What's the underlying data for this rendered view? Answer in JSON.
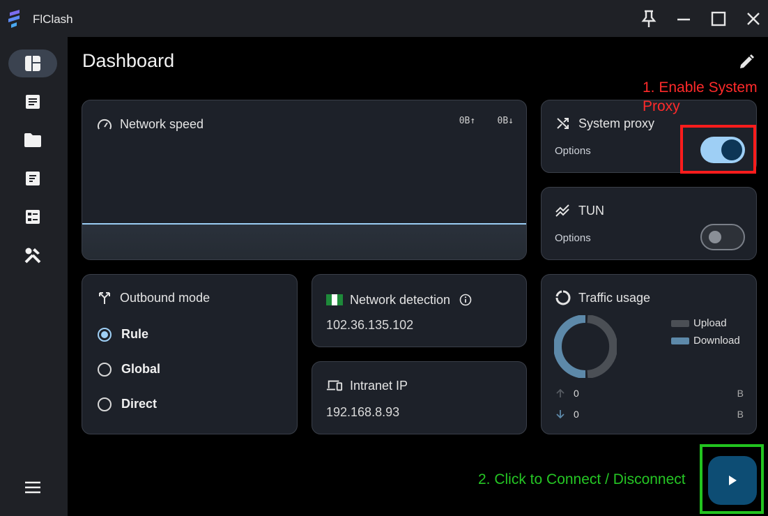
{
  "app": {
    "title": "FlClash"
  },
  "page": {
    "title": "Dashboard"
  },
  "network_speed": {
    "title": "Network speed",
    "upload": "0B↑",
    "download": "0B↓"
  },
  "system_proxy": {
    "title": "System proxy",
    "options_label": "Options",
    "enabled": true
  },
  "tun": {
    "title": "TUN",
    "options_label": "Options",
    "enabled": false
  },
  "outbound_mode": {
    "title": "Outbound mode",
    "options": [
      "Rule",
      "Global",
      "Direct"
    ],
    "selected": "Rule"
  },
  "network_detection": {
    "title": "Network detection",
    "ip": "102.36.135.102"
  },
  "intranet_ip": {
    "title": "Intranet IP",
    "ip": "192.168.8.93"
  },
  "traffic_usage": {
    "title": "Traffic usage",
    "legend": {
      "upload": "Upload",
      "download": "Download"
    },
    "upload_value": "0",
    "upload_unit": "B",
    "download_value": "0",
    "download_unit": "B",
    "colors": {
      "upload": "#4b4f55",
      "download": "#5d89a9"
    }
  },
  "annotations": {
    "enable_proxy": "1. Enable System Proxy",
    "connect": "2. Click to Connect / Disconnect"
  },
  "colors": {
    "accent": "#9ecff5",
    "connect_button": "#0d4d74",
    "card": "#1d2129"
  }
}
